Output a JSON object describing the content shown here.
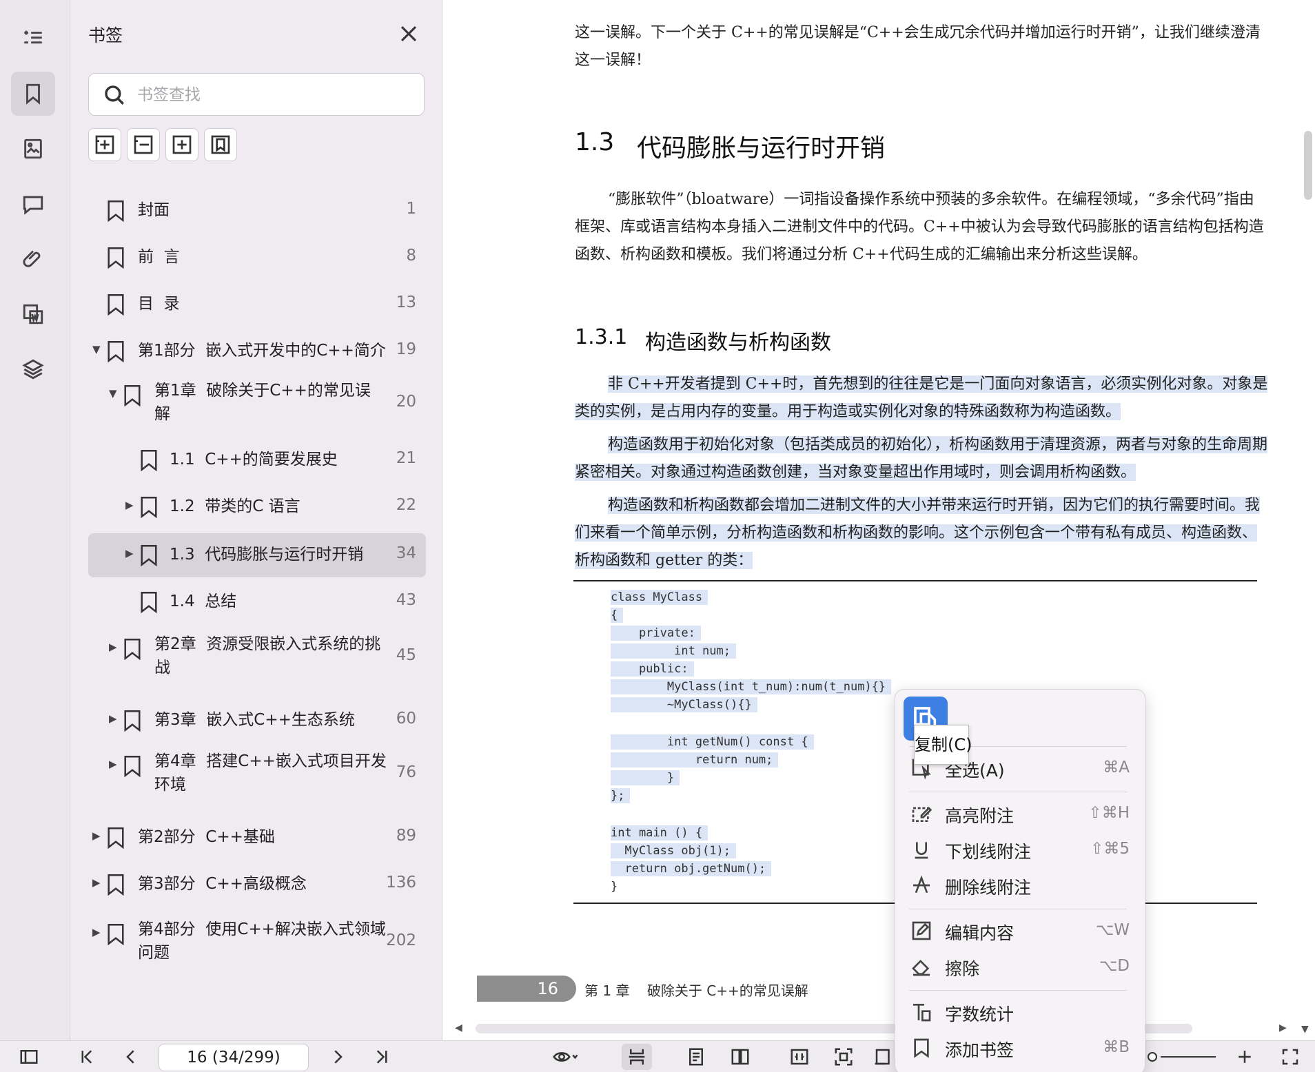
{
  "panel": {
    "title": "书签",
    "search_placeholder": "书签查找",
    "bookmarks": [
      {
        "label": "封面",
        "page": "1"
      },
      {
        "label": "前  言",
        "page": "8"
      },
      {
        "label": "目  录",
        "page": "13"
      },
      {
        "label": "第1部分  嵌入式开发中的C++简介",
        "page": "19"
      },
      {
        "label": "第1章  破除关于C++的常见误解",
        "page": "20"
      },
      {
        "label": "1.1  C++的简要发展史",
        "page": "21"
      },
      {
        "label": "1.2  带类的C 语言",
        "page": "22"
      },
      {
        "label": "1.3  代码膨胀与运行时开销",
        "page": "34"
      },
      {
        "label": "1.4  总结",
        "page": "43"
      },
      {
        "label": "第2章  资源受限嵌入式系统的挑战",
        "page": "45"
      },
      {
        "label": "第3章  嵌入式C++生态系统",
        "page": "60"
      },
      {
        "label": "第4章  搭建C++嵌入式项目开发环境",
        "page": "76"
      },
      {
        "label": "第2部分  C++基础",
        "page": "89"
      },
      {
        "label": "第3部分  C++高级概念",
        "page": "136"
      },
      {
        "label": "第4部分  使用C++解决嵌入式领域问题",
        "page": "202"
      }
    ]
  },
  "document": {
    "intro": "这一误解。下一个关于 C++的常见误解是“C++会生成冗余代码并增加运行时开销”，让我们继续澄清这一误解！",
    "section_number": "1.3",
    "section_title": "代码膨胀与运行时开销",
    "para1": "“膨胀软件”（bloatware）一词指设备操作系统中预装的多余软件。在编程领域，“多余代码”指由框架、库或语言结构本身插入二进制文件中的代码。C++中被认为会导致代码膨胀的语言结构包括构造函数、析构函数和模板。我们将通过分析 C++代码生成的汇编输出来分析这些误解。",
    "subsection_number": "1.3.1",
    "subsection_title": "构造函数与析构函数",
    "para2": "非 C++开发者提到 C++时，首先想到的往往是它是一门面向对象语言，必须实例化对象。对象是类的实例，是占用内存的变量。用于构造或实例化对象的特殊函数称为构造函数。",
    "para3": "构造函数用于初始化对象（包括类成员的初始化），析构函数用于清理资源，两者与对象的生命周期紧密相关。对象通过构造函数创建，当对象变量超出作用域时，则会调用析构函数。",
    "para4": "构造函数和析构函数都会增加二进制文件的大小并带来运行时开销，因为它们的执行需要时间。我们来看一个简单示例，分析构造函数和析构函数的影响。这个示例包含一个带有私有成员、构造函数、析构函数和 getter 的类：",
    "code": [
      "class MyClass",
      "{",
      "    private:",
      "         int num;",
      "    public:",
      "        MyClass(int t_num):num(t_num){}",
      "        ~MyClass(){}",
      "        int getNum() const {",
      "            return num;",
      "        }",
      "};",
      "int main () {",
      "  MyClass obj(1);",
      "  return obj.getNum();",
      "}"
    ],
    "footer_page": "16",
    "footer_chapter": "第 1 章    破除关于 C++的常见误解"
  },
  "toolbar": {
    "page_indicator": "16 (34/299)"
  },
  "context_menu": {
    "tooltip": "复制(C)",
    "items": [
      {
        "label": "全选(A)",
        "shortcut": "⌘A"
      },
      {
        "label": "高亮附注",
        "shortcut": "⇧⌘H"
      },
      {
        "label": "下划线附注",
        "shortcut": "⇧⌘5"
      },
      {
        "label": "删除线附注",
        "shortcut": ""
      },
      {
        "label": "编辑内容",
        "shortcut": "⌥W"
      },
      {
        "label": "擦除",
        "shortcut": "⌥D"
      },
      {
        "label": "字数统计",
        "shortcut": ""
      },
      {
        "label": "添加书签",
        "shortcut": "⌘B"
      }
    ]
  },
  "colors": {
    "accent": "#3d7fe3",
    "selection": "#dbe5f6",
    "selected_row": "#d8d3da"
  }
}
